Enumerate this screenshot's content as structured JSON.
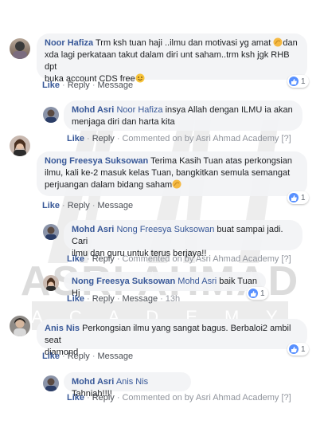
{
  "watermark": {
    "main": "ASRI AHMAD",
    "sub": "A C A D E M Y"
  },
  "action_labels": {
    "like": "Like",
    "reply": "Reply",
    "message": "Message",
    "commented_on_by": "Commented on by Asri Ahmad Academy",
    "bracket": "[?]",
    "sep": "·"
  },
  "comments": [
    {
      "author": "Noor Hafiza",
      "line1": "Trm ksh tuan haji ..ilmu dan motivasi yg amat ",
      "line1b": "dan",
      "line2": "xda lagi perkataan takut dalam diri unt saham..trm ksh jgk RHB dpt",
      "line3": "buka account CDS free",
      "reactions": "1",
      "actions_type": "message"
    },
    {
      "author": "Mohd Asri",
      "mention": "Noor Hafiza",
      "line1": " insya Allah dengan ILMU ia akan",
      "line2": "menjaga diri dan harta kita",
      "actions_type": "commented"
    },
    {
      "author": "Nong Freesya Suksowan",
      "line1": " Terima Kasih Tuan atas perkongsian",
      "line2": "ilmu, kali ke-2 masuk kelas Tuan, bangkitkan semula semangat",
      "line3": "perjuangan dalam bidang saham",
      "reactions": "1",
      "actions_type": "message"
    },
    {
      "author": "Mohd Asri",
      "mention": "Nong Freesya Suksowan",
      "line1": " buat sampai jadi. Cari",
      "line2": "ilmu dan guru untuk terus berjaya!!",
      "actions_type": "commented"
    },
    {
      "author": "Nong Freesya Suksowan",
      "mention": "Mohd Asri",
      "line1": " baik Tuan Hj",
      "reactions": "1",
      "time": "13h",
      "actions_type": "message_time"
    },
    {
      "author": "Anis Nis",
      "line1": " Perkongsian ilmu yang sangat bagus. Berbaloi2 ambil seat",
      "line2": "diamond",
      "reactions": "1",
      "actions_type": "message"
    },
    {
      "author": "Mohd Asri",
      "mention": "Anis Nis",
      "line1": " Tahniah!!!!",
      "actions_type": "commented"
    }
  ]
}
